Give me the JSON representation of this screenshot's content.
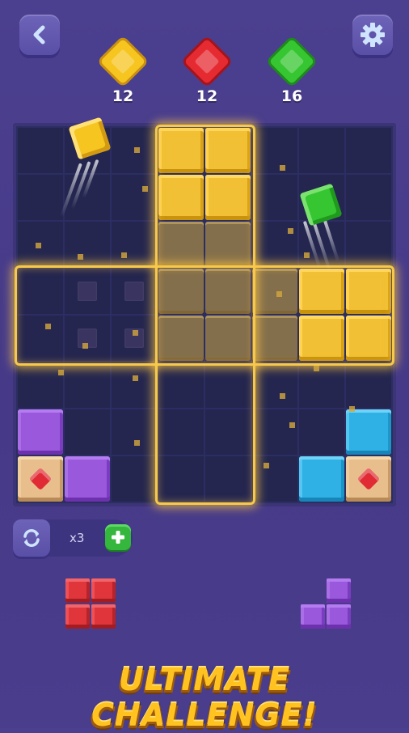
{
  "header": {
    "back_icon": "chevron-left-icon",
    "settings_icon": "gear-icon"
  },
  "gems": [
    {
      "color": "yellow",
      "hex": "#f6c51f",
      "count": "12"
    },
    {
      "color": "red",
      "hex": "#e62a32",
      "count": "12"
    },
    {
      "color": "green",
      "hex": "#36c631",
      "count": "16"
    }
  ],
  "colors": {
    "background": "#4b3f8f",
    "board": "#2c2d62",
    "yellow_block": "#f2c034",
    "purple_block": "#9a58dc",
    "blue_block": "#2fb1e6",
    "red_piece": "#e0353a",
    "glow": "#f7c94a"
  },
  "swap": {
    "icon": "refresh-icon",
    "count": "x3",
    "plus_icon": "plus-icon"
  },
  "pieces": [
    {
      "name": "red-square-piece",
      "color": "red"
    },
    {
      "name": "purple-l-piece",
      "color": "purple"
    }
  ],
  "banner": {
    "text": "ULTIMATE CHALLENGE!"
  }
}
